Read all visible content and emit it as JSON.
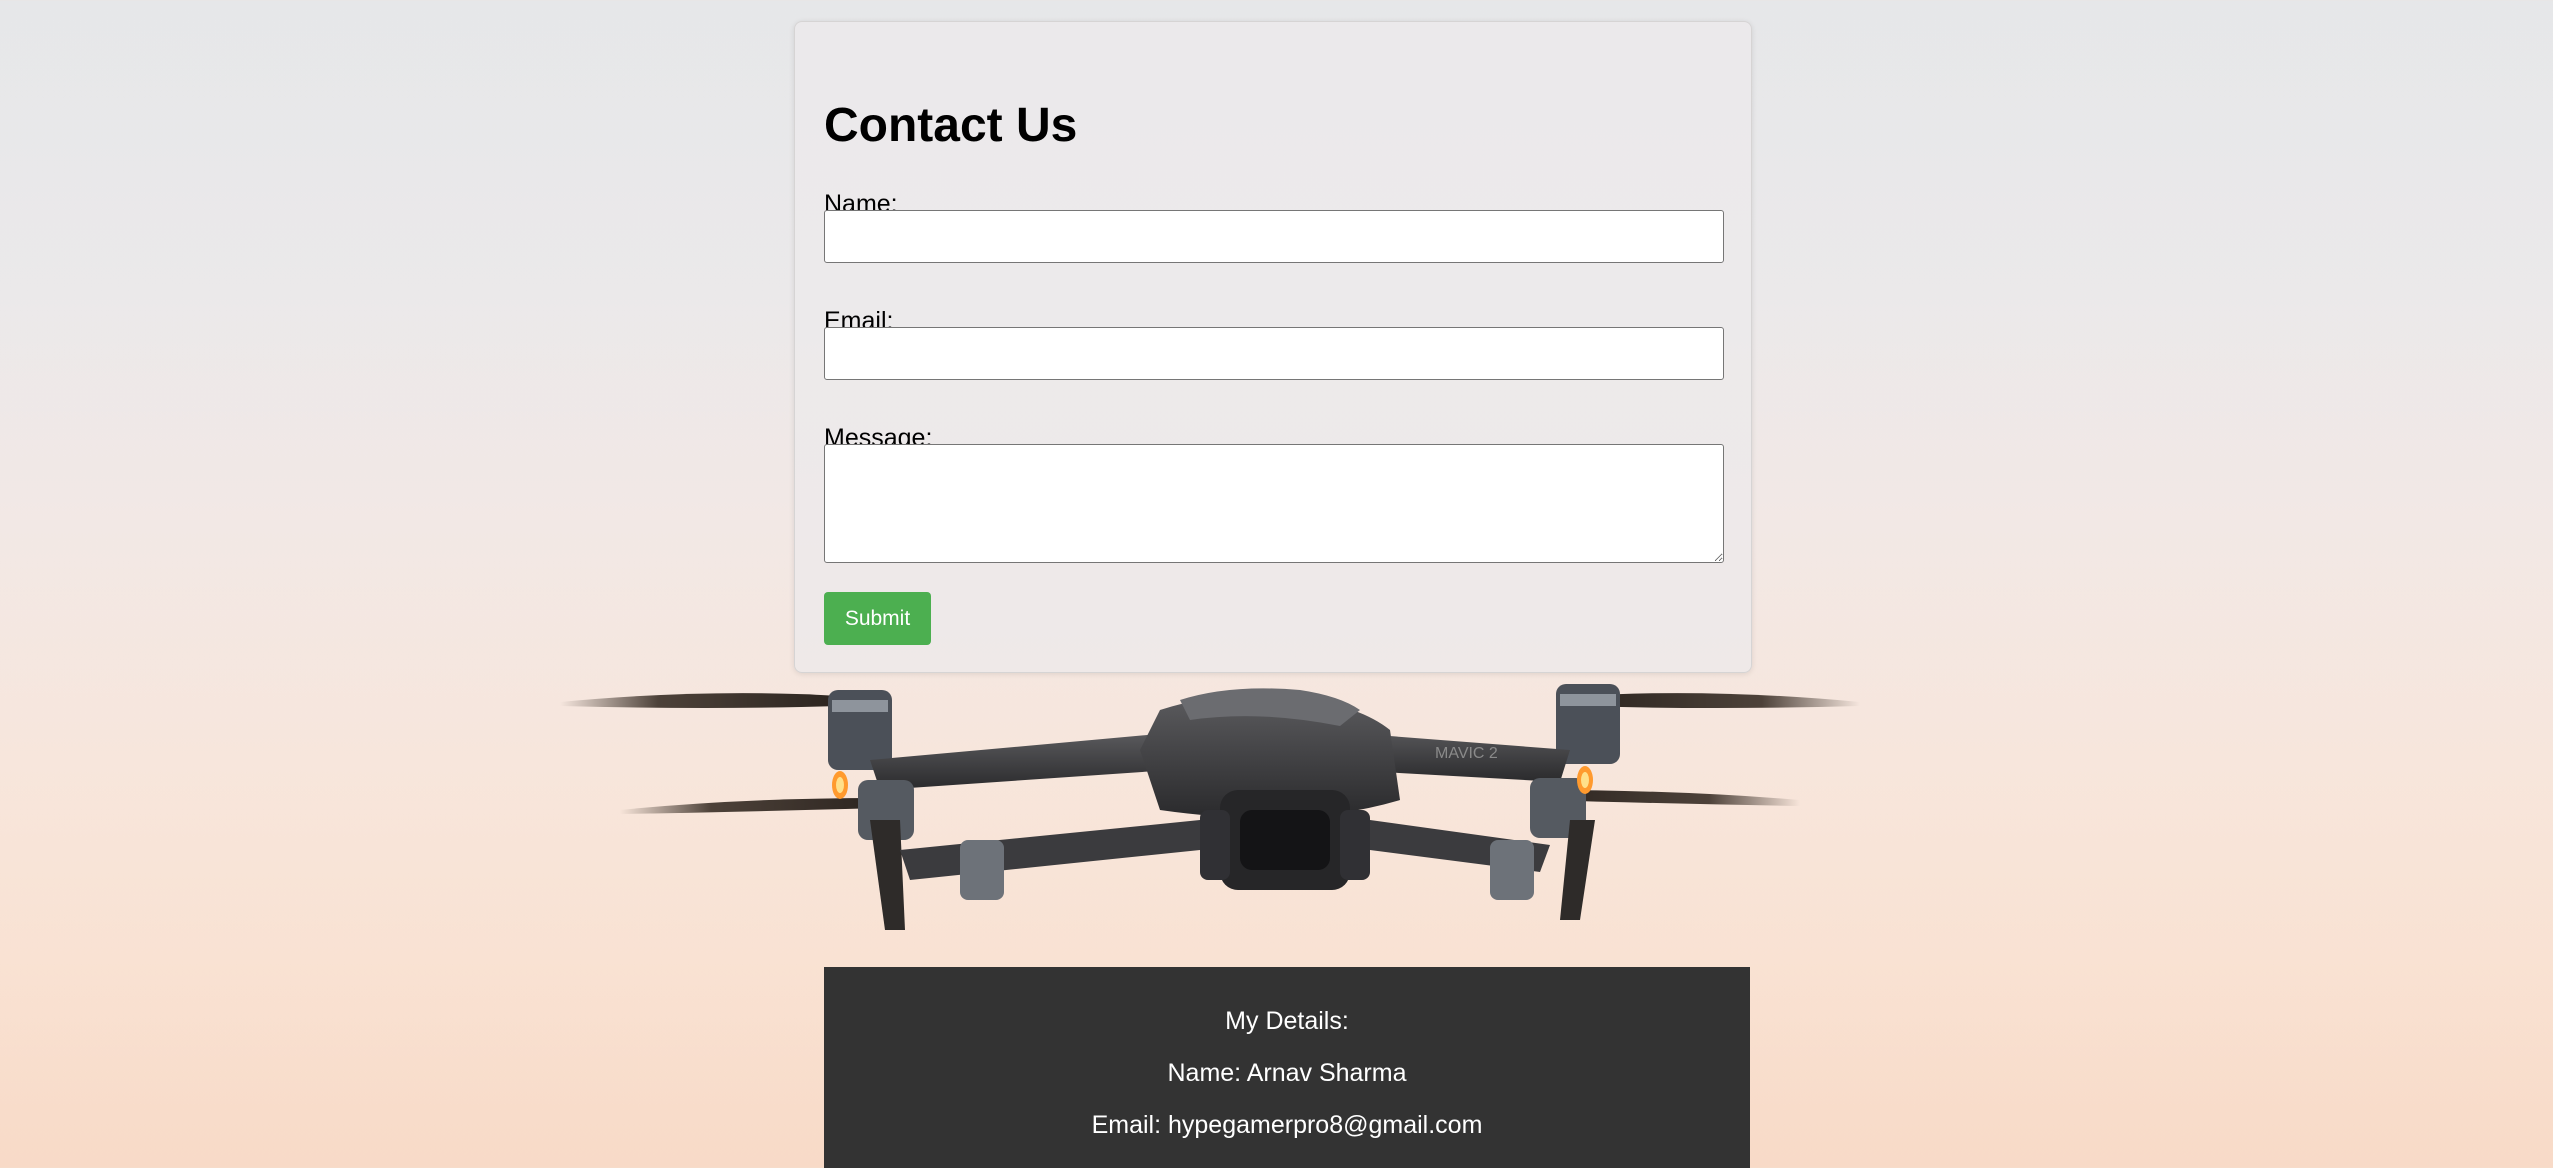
{
  "contact_form": {
    "title": "Contact Us",
    "name_label": "Name:",
    "name_value": "",
    "email_label": "Email:",
    "email_value": "",
    "message_label": "Message:",
    "message_value": "",
    "submit_label": "Submit"
  },
  "drone": {
    "icon": "drone-image",
    "model_text": "MAVIC 2"
  },
  "details": {
    "heading": "My Details:",
    "name_line": "Name: Arnav Sharma",
    "email_line": "Email: hypegamerpro8@gmail.com"
  },
  "colors": {
    "submit_button": "#4caf50",
    "details_background": "#333333",
    "background_top": "#e6e7e9",
    "background_bottom": "#f8dac7"
  }
}
